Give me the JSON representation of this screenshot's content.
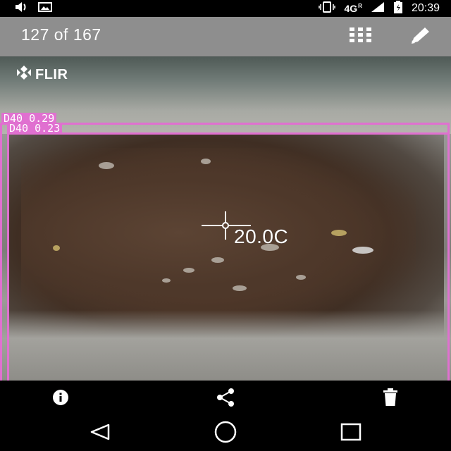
{
  "status_bar": {
    "network": "4G",
    "roaming": "R",
    "time": "20:39"
  },
  "app_bar": {
    "title": "127 of 167",
    "icons": [
      "grid-icon",
      "edit-icon"
    ]
  },
  "image": {
    "logo_text": "FLIR",
    "temperature_readout": "20.0C",
    "detections": [
      {
        "label": "D40 0.29"
      },
      {
        "label": "D40 0.23"
      }
    ],
    "box_color": "#e070d0"
  },
  "action_bar": {
    "icons": [
      "info-icon",
      "share-icon",
      "delete-icon"
    ]
  },
  "nav_bar": {
    "icons": [
      "back-icon",
      "home-icon",
      "recents-icon"
    ]
  }
}
